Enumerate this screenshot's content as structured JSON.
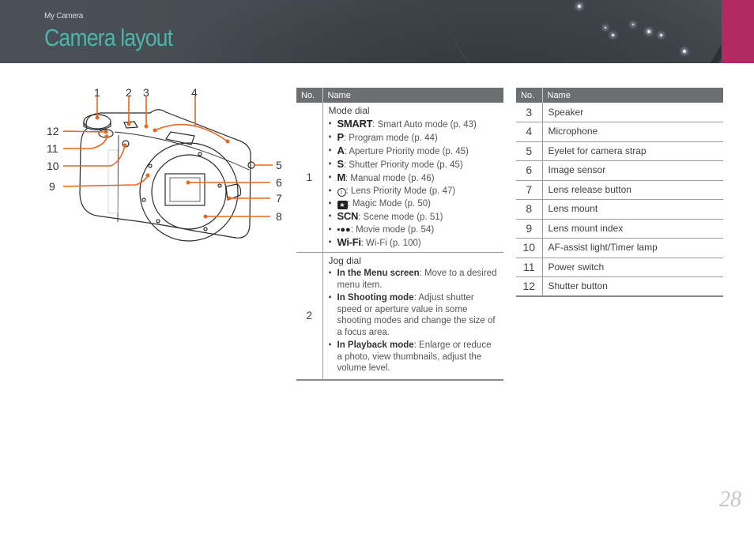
{
  "header": {
    "breadcrumb": "My Camera",
    "title": "Camera layout",
    "accent_color": "#b32a63",
    "title_color": "#4fb3a9"
  },
  "figure": {
    "subject": "camera-front-view",
    "callouts": [
      "1",
      "2",
      "3",
      "4",
      "5",
      "6",
      "7",
      "8",
      "9",
      "10",
      "11",
      "12"
    ],
    "leader_color": "#e8671e"
  },
  "table_a": {
    "headers": {
      "no": "No.",
      "name": "Name"
    },
    "rows": [
      {
        "no": "1",
        "title": "Mode dial",
        "items": [
          {
            "symbol": "SMART",
            "text": ": Smart Auto mode (p. 43)"
          },
          {
            "symbol": "P",
            "text": ": Program mode (p. 44)"
          },
          {
            "symbol": "A",
            "text": ": Aperture Priority mode (p. 45)"
          },
          {
            "symbol": "S",
            "text": ": Shutter Priority mode (p. 45)"
          },
          {
            "symbol": "M",
            "text": ": Manual mode (p. 46)"
          },
          {
            "icon": "lens-priority-icon",
            "glyph": "i",
            "text": ": Lens Priority Mode (p. 47)"
          },
          {
            "icon": "magic-mode-icon",
            "glyph": "★",
            "text": ": Magic Mode (p. 50)"
          },
          {
            "symbol": "SCN",
            "text": ": Scene mode (p. 51)"
          },
          {
            "icon": "movie-camera-icon",
            "glyph": "🎥",
            "text": ": Movie mode (p. 54)"
          },
          {
            "symbol": "Wi-Fi",
            "text": ": Wi-Fi (p. 100)"
          }
        ]
      },
      {
        "no": "2",
        "title": "Jog dial",
        "items": [
          {
            "bold": "In the Menu screen",
            "text": ": Move to a desired menu item."
          },
          {
            "bold": "In Shooting mode",
            "text": ": Adjust shutter speed or aperture value in some shooting modes and change the size of a focus area."
          },
          {
            "bold": "In Playback mode",
            "text": ": Enlarge or reduce a photo, view thumbnails, adjust the volume level."
          }
        ]
      }
    ]
  },
  "table_b": {
    "headers": {
      "no": "No.",
      "name": "Name"
    },
    "rows": [
      {
        "no": "3",
        "name": "Speaker"
      },
      {
        "no": "4",
        "name": "Microphone"
      },
      {
        "no": "5",
        "name": "Eyelet for camera strap"
      },
      {
        "no": "6",
        "name": "Image sensor"
      },
      {
        "no": "7",
        "name": "Lens release button"
      },
      {
        "no": "8",
        "name": "Lens mount"
      },
      {
        "no": "9",
        "name": "Lens mount index"
      },
      {
        "no": "10",
        "name": "AF-assist light/Timer lamp"
      },
      {
        "no": "11",
        "name": "Power switch"
      },
      {
        "no": "12",
        "name": "Shutter button"
      }
    ]
  },
  "page_number": "28"
}
